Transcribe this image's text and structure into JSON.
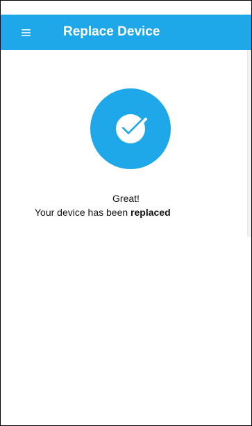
{
  "app_bar": {
    "title": "Replace Device",
    "background_color": "#1ea8ea",
    "menu_icon": "hamburger-menu-icon"
  },
  "status": {
    "icon": "check-circle-icon",
    "icon_color": "#1ea8ea",
    "heading": "Great!",
    "message_prefix": "Your device has been",
    "message_emphasis": "replaced"
  }
}
